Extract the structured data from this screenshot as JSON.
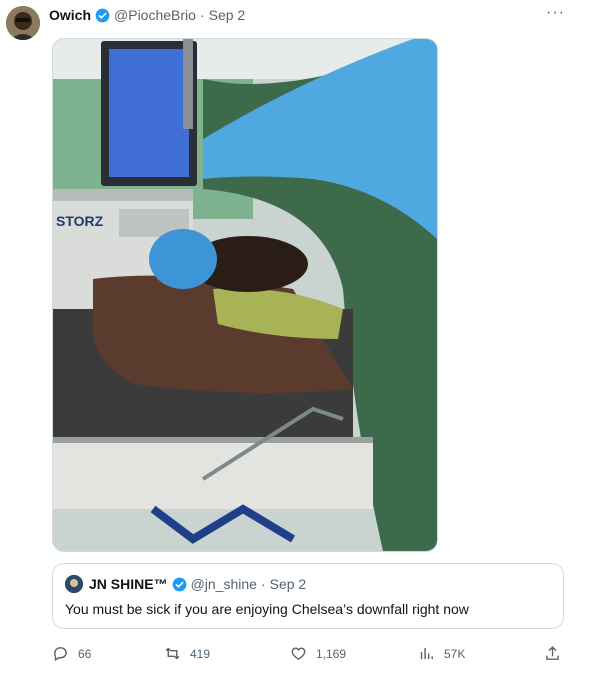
{
  "tweet": {
    "author_name": "Owich",
    "handle": "@PiocheBrio",
    "separator": "·",
    "date": "Sep 2",
    "more_label": "···"
  },
  "photo": {
    "monitor_brand": "STORZ"
  },
  "quoted": {
    "author_name": "JN SHINE™",
    "handle": "@jn_shine",
    "separator": "·",
    "date": "Sep 2",
    "text": "You must be sick if you are enjoying Chelsea’s downfall right now"
  },
  "actions": {
    "replies": "66",
    "retweets": "419",
    "likes": "1,169",
    "views": "57K"
  },
  "colors": {
    "verified": "#1d9bf0",
    "muted_text": "#536471",
    "border": "#cfd9de",
    "surgical_blue": "#4fa8e0",
    "drape_green": "#3c6a4a"
  },
  "icons": {
    "verified": "verified-badge-icon",
    "reply": "reply-icon",
    "retweet": "retweet-icon",
    "like": "heart-icon",
    "views": "bar-chart-icon",
    "share": "share-icon",
    "more": "more-dots-icon"
  }
}
